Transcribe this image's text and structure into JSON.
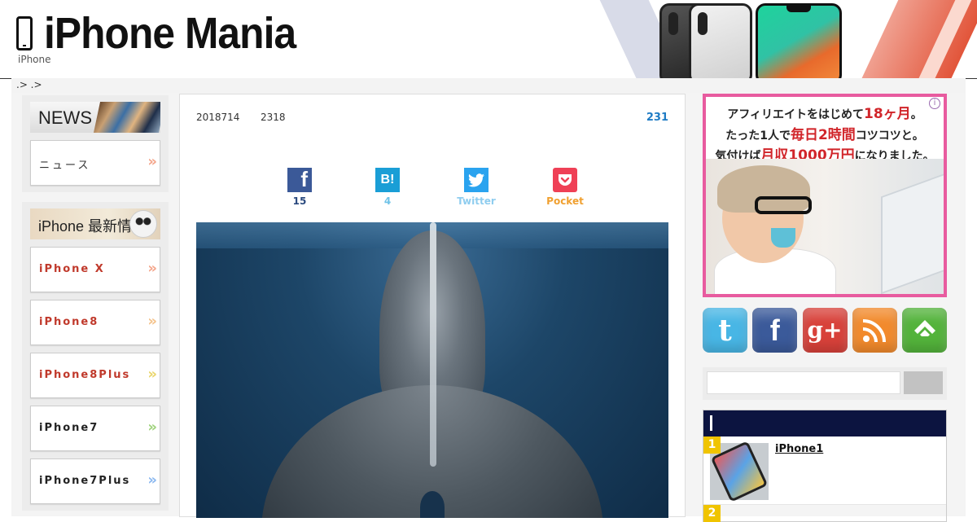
{
  "site": {
    "title": "iPhone Mania",
    "tagline": "iPhone"
  },
  "breadcrumb": " .> .>",
  "left": {
    "news_box": {
      "title": "NEWS",
      "items": [
        {
          "label": "ニュース",
          "arrow": "»",
          "color": "#f4a58a"
        }
      ]
    },
    "info_box": {
      "title": "iPhone 最新情報",
      "items": [
        {
          "label": "iPhone X",
          "color": "#c0392b",
          "arrow": "»",
          "arrow_color": "#f4a58a"
        },
        {
          "label": "iPhone8",
          "color": "#c0392b",
          "arrow": "»",
          "arrow_color": "#f4c28a"
        },
        {
          "label": "iPhone8Plus",
          "color": "#c0392b",
          "arrow": "»",
          "arrow_color": "#e9d56a"
        },
        {
          "label": "iPhone7",
          "color": "#222222",
          "arrow": "»",
          "arrow_color": "#9ed27a"
        },
        {
          "label": "iPhone7Plus",
          "color": "#222222",
          "arrow": "»",
          "arrow_color": "#8ab8f0"
        }
      ]
    }
  },
  "article": {
    "date": "2018714",
    "time": "2318",
    "views": "231",
    "share": [
      {
        "name": "facebook",
        "icon": "f",
        "count": "15",
        "color": "#3b5998",
        "count_color": "#2b4a7f"
      },
      {
        "name": "hatena",
        "icon": "B!",
        "count": "4",
        "color": "#1a9ed6",
        "count_color": "#6fc3e8"
      },
      {
        "name": "twitter",
        "icon": "twitter-bird",
        "count": "Twitter",
        "color": "#2aa3ef",
        "count_color": "#8fcdef"
      },
      {
        "name": "pocket",
        "icon": "pocket",
        "count": "Pocket",
        "color": "#ef4056",
        "count_color": "#f0a030"
      }
    ]
  },
  "ad": {
    "line1_a": "アフィリエイトをはじめて",
    "line1_b": "18ヶ月",
    "line1_c": "。",
    "line2_a": "たった1人で",
    "line2_b": "毎日2時間",
    "line2_c": "コツコツと。",
    "line3_a": "気付けば",
    "line3_b": "月収1000万円",
    "line3_c": "になりました。",
    "info": "i"
  },
  "social": [
    {
      "name": "twitter",
      "glyph": "t",
      "color": "#48b6e5"
    },
    {
      "name": "facebook",
      "glyph": "f",
      "color": "#3b5a9a"
    },
    {
      "name": "google-plus",
      "glyph": "g+",
      "color": "#d8413a"
    },
    {
      "name": "rss",
      "glyph": "rss",
      "color": "#f28a2c"
    },
    {
      "name": "feedly",
      "glyph": "feedly",
      "color": "#53b33b"
    }
  ],
  "ranking": {
    "items": [
      {
        "rank": "1",
        "title": "iPhone1"
      }
    ],
    "next_rank": "2"
  }
}
